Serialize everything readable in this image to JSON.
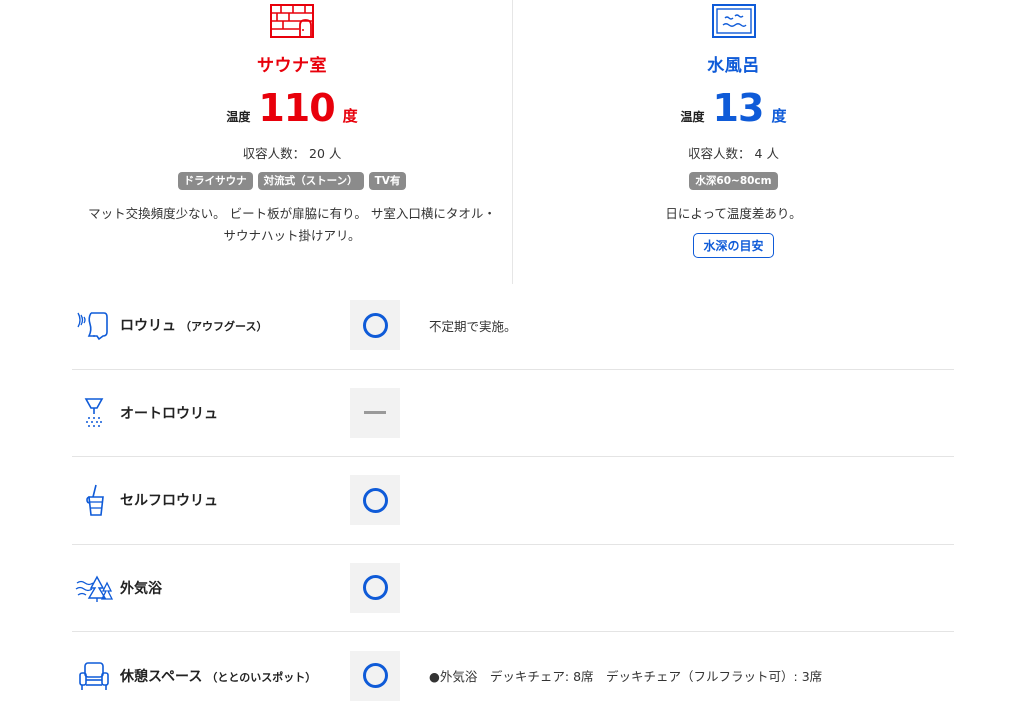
{
  "colors": {
    "sauna_red": "#e8000b",
    "water_blue": "#0f5bd8",
    "tag_gray": "#8b8b8b"
  },
  "sauna": {
    "icon": "sauna-room-icon",
    "title": "サウナ室",
    "temp_label": "温度",
    "temp_value": "110",
    "temp_unit": "度",
    "capacity": "収容人数： 20 人",
    "tags": [
      "ドライサウナ",
      "対流式（ストーン）",
      "TV有"
    ],
    "description": "マット交換頻度少ない。 ビート板が扉脇に有り。 サ室入口横にタオル・サウナハット掛けアリ。"
  },
  "water_bath": {
    "icon": "water-bath-icon",
    "title": "水風呂",
    "temp_label": "温度",
    "temp_value": "13",
    "temp_unit": "度",
    "capacity": "収容人数： 4 人",
    "tags": [
      "水深60~80cm"
    ],
    "description": "日によって温度差あり。",
    "depth_button": "水深の目安"
  },
  "features": [
    {
      "icon": "loyly-aufguss-icon",
      "label": "ロウリュ",
      "sub": "（アウフグース）",
      "mark": "circle",
      "note": "不定期で実施。"
    },
    {
      "icon": "auto-loyly-icon",
      "label": "オートロウリュ",
      "sub": "",
      "mark": "dash",
      "note": ""
    },
    {
      "icon": "self-loyly-icon",
      "label": "セルフロウリュ",
      "sub": "",
      "mark": "circle",
      "note": ""
    },
    {
      "icon": "outdoor-air-bath-icon",
      "label": "外気浴",
      "sub": "",
      "mark": "circle",
      "note": ""
    },
    {
      "icon": "rest-space-icon",
      "label": "休憩スペース",
      "sub": "（ととのいスポット）",
      "mark": "circle",
      "note": "●外気浴　デッキチェア: 8席　デッキチェア（フルフラット可）: 3席"
    }
  ]
}
